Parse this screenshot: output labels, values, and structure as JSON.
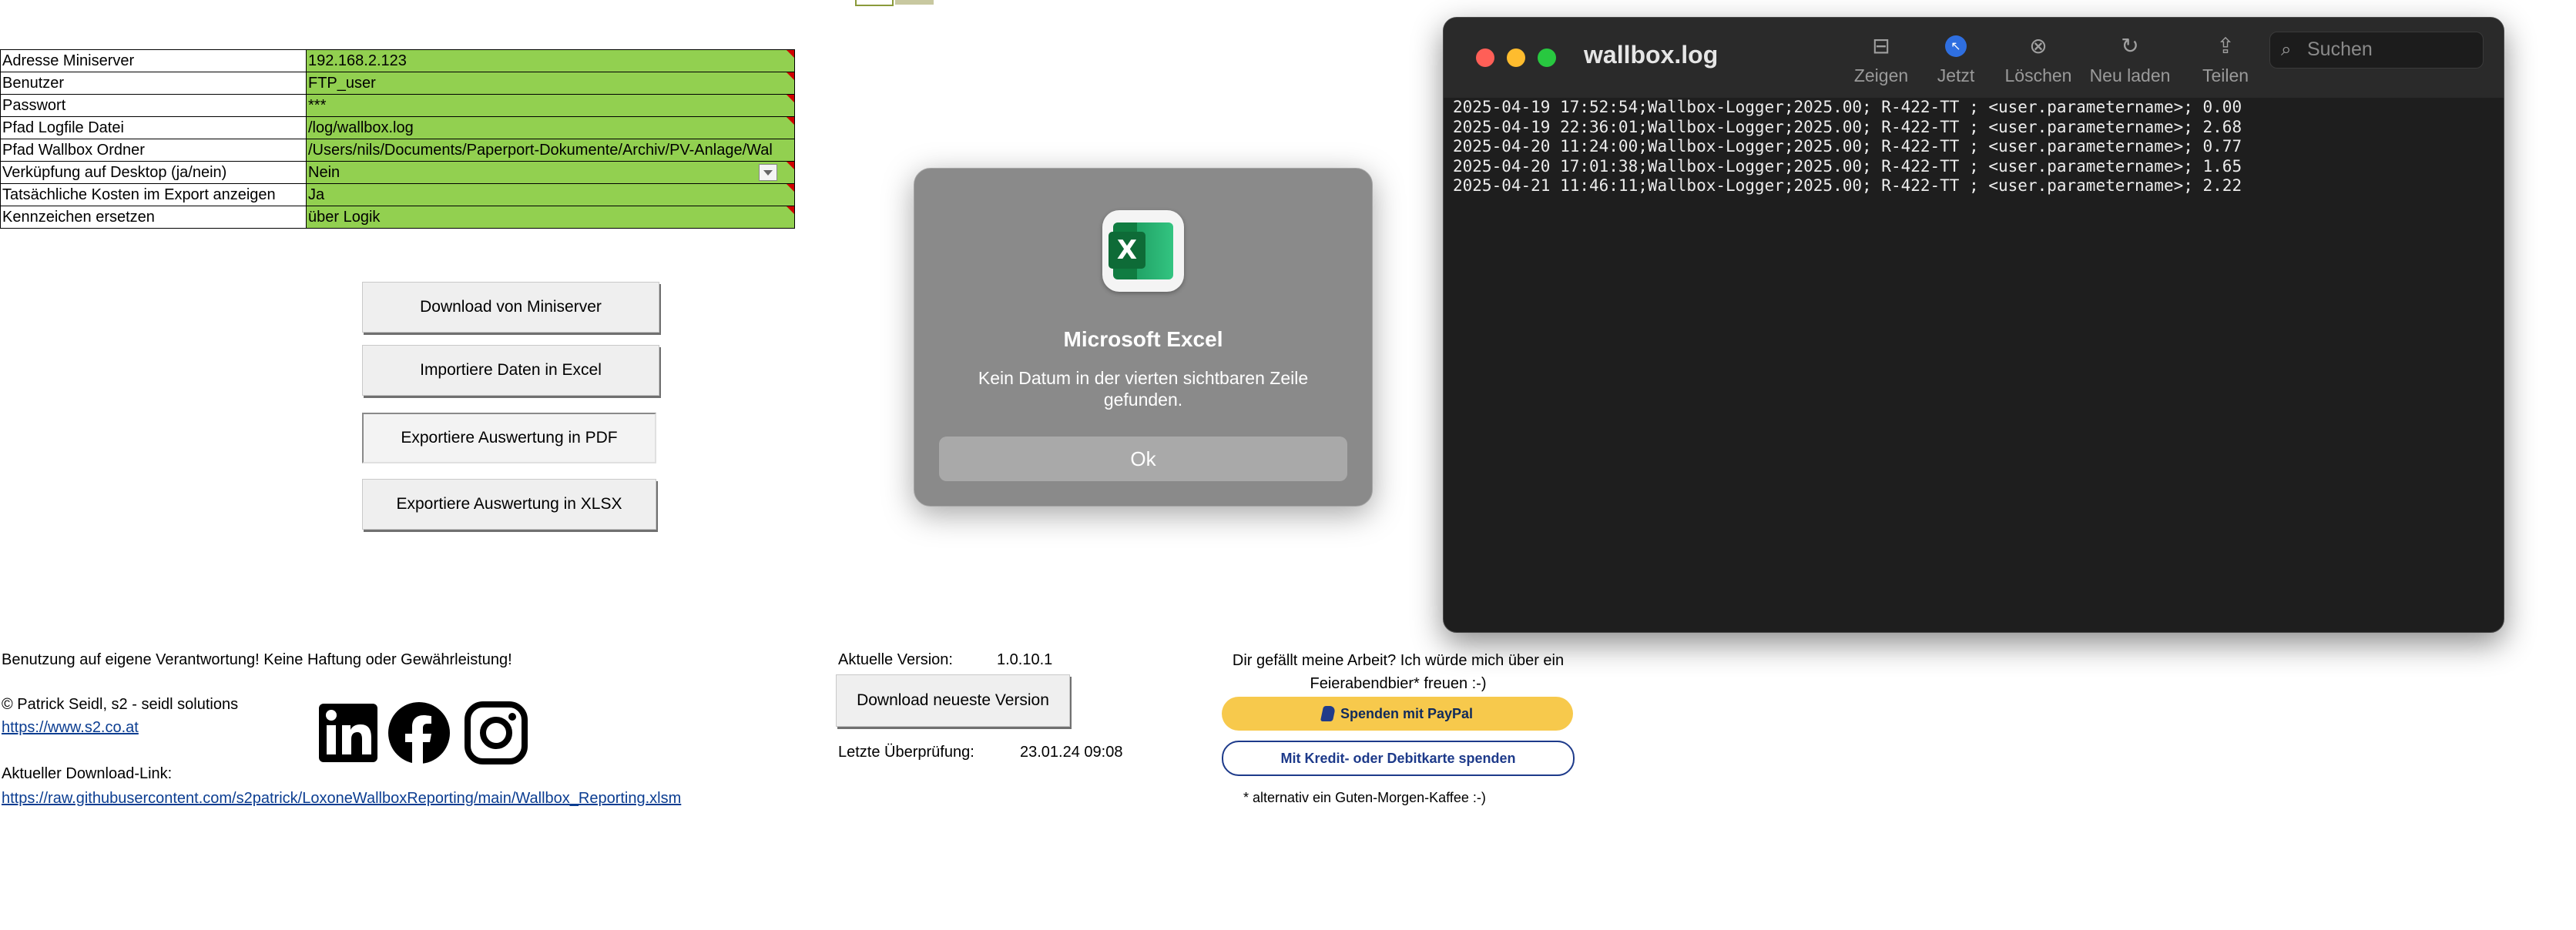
{
  "settings": {
    "rows": [
      {
        "label": "Adresse Miniserver",
        "value": "192.168.2.123"
      },
      {
        "label": "Benutzer",
        "value": "FTP_user"
      },
      {
        "label": "Passwort",
        "value": "***"
      },
      {
        "label": "Pfad Logfile Datei",
        "value": "/log/wallbox.log"
      },
      {
        "label": "Pfad Wallbox Ordner",
        "value": "/Users/nils/Documents/Paperport-Dokumente/Archiv/PV-Anlage/Wal"
      },
      {
        "label": "Verküpfung auf Desktop (ja/nein)",
        "value": "Nein"
      },
      {
        "label": "Tatsächliche Kosten im Export anzeigen",
        "value": "Ja"
      },
      {
        "label": "Kennzeichen ersetzen",
        "value": "über Logik"
      }
    ]
  },
  "buttons": {
    "download_miniserver": "Download von Miniserver",
    "import_excel": "Importiere Daten in Excel",
    "export_pdf": "Exportiere Auswertung in PDF",
    "export_xlsx": "Exportiere Auswertung in XLSX"
  },
  "footer": {
    "disclaimer": "Benutzung auf eigene Verantwortung! Keine Haftung oder Gewährleistung!",
    "copyright": "© Patrick Seidl, s2 - seidl solutions",
    "website": "https://www.s2.co.at",
    "download_link_label": "Aktueller Download-Link:",
    "download_link": "https://raw.githubusercontent.com/s2patrick/LoxoneWallboxReporting/main/Wallbox_Reporting.xlsm",
    "version_label": "Aktuelle Version:",
    "version_value": "1.0.10.1",
    "download_latest": "Download neueste Version",
    "last_check_label": "Letzte Überprüfung:",
    "last_check_value": "23.01.24 09:08",
    "donate_text": "Dir gefällt meine Arbeit? Ich würde mich über ein Feierabendbier* freuen :-)",
    "paypal": "Spenden mit PayPal",
    "card": "Mit Kredit- oder Debitkarte spenden",
    "alt_note": "* alternativ ein Guten-Morgen-Kaffee :-)"
  },
  "social_icons": [
    "linkedin-icon",
    "facebook-icon",
    "instagram-icon"
  ],
  "dialog": {
    "app_name": "Microsoft Excel",
    "message": "Kein Datum in der vierten sichtbaren Zeile gefunden.",
    "ok": "Ok"
  },
  "console": {
    "title": "wallbox.log",
    "toolbar": [
      {
        "icon": "show-icon",
        "label": "Zeigen"
      },
      {
        "icon": "now-icon",
        "label": "Jetzt"
      },
      {
        "icon": "clear-icon",
        "label": "Löschen"
      },
      {
        "icon": "reload-icon",
        "label": "Neu laden"
      },
      {
        "icon": "share-icon",
        "label": "Teilen"
      }
    ],
    "search_placeholder": "Suchen",
    "lines": [
      "2025-04-19 17:52:54;Wallbox-Logger;2025.00; R-422-TT ; <user.parametername>; 0.00",
      "2025-04-19 22:36:01;Wallbox-Logger;2025.00; R-422-TT ; <user.parametername>; 2.68",
      "2025-04-20 11:24:00;Wallbox-Logger;2025.00; R-422-TT ; <user.parametername>; 0.77",
      "2025-04-20 17:01:38;Wallbox-Logger;2025.00; R-422-TT ; <user.parametername>; 1.65",
      "2025-04-21 11:46:11;Wallbox-Logger;2025.00; R-422-TT ; <user.parametername>; 2.22"
    ]
  },
  "colors": {
    "cell_green": "#92d050",
    "paypal_yellow": "#f7c94c",
    "console_bg": "#1e1e1e",
    "dialog_bg": "#8a8a8a"
  }
}
